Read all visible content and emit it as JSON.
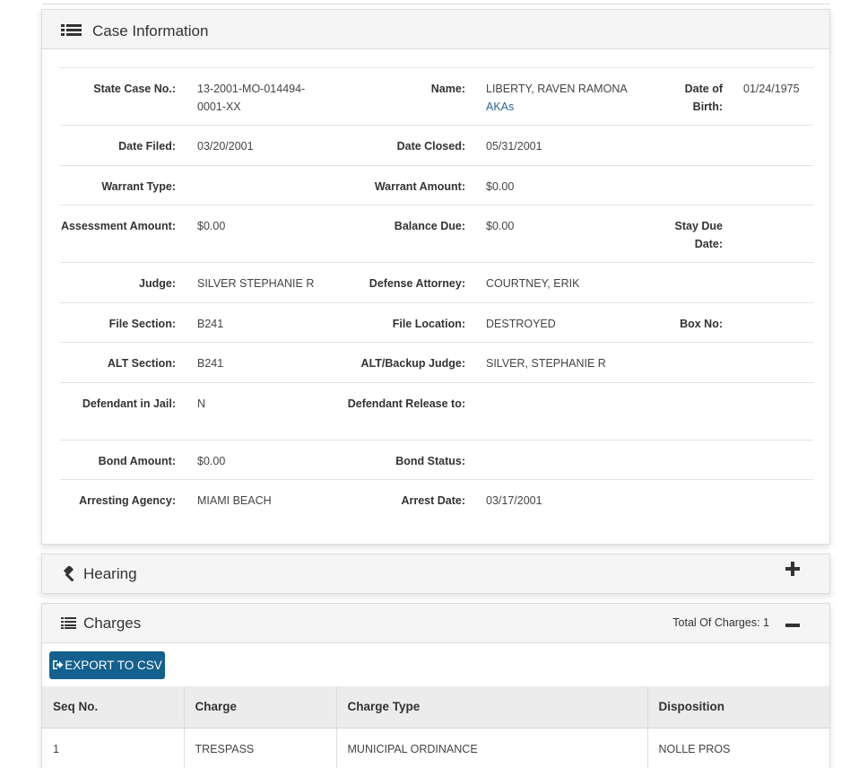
{
  "case_panel": {
    "title": "Case Information",
    "icon": "list-icon",
    "rows": [
      [
        {
          "label": "State Case No.:",
          "value": "13-2001-MO-014494-0001-XX"
        },
        {
          "label": "Name:",
          "value": "LIBERTY, RAVEN RAMONA",
          "link": "AKAs"
        },
        {
          "label": "Date of Birth:",
          "value": "01/24/1975"
        }
      ],
      [
        {
          "label": "Date Filed:",
          "value": "03/20/2001"
        },
        {
          "label": "Date Closed:",
          "value": "05/31/2001"
        },
        {
          "label": "",
          "value": ""
        }
      ],
      [
        {
          "label": "Warrant Type:",
          "value": ""
        },
        {
          "label": "Warrant Amount:",
          "value": "$0.00"
        },
        {
          "label": "",
          "value": ""
        }
      ],
      [
        {
          "label": "Assessment Amount:",
          "value": "$0.00"
        },
        {
          "label": "Balance Due:",
          "value": "$0.00"
        },
        {
          "label": "Stay Due Date:",
          "value": ""
        }
      ],
      [
        {
          "label": "Judge:",
          "value": "SILVER STEPHANIE R"
        },
        {
          "label": "Defense Attorney:",
          "value": "COURTNEY, ERIK"
        },
        {
          "label": "",
          "value": ""
        }
      ],
      [
        {
          "label": "File Section:",
          "value": "B241"
        },
        {
          "label": "File Location:",
          "value": "DESTROYED"
        },
        {
          "label": "Box No:",
          "value": ""
        }
      ],
      [
        {
          "label": "ALT Section:",
          "value": "B241"
        },
        {
          "label": "ALT/Backup Judge:",
          "value": "SILVER, STEPHANIE R"
        },
        {
          "label": "",
          "value": ""
        }
      ],
      [
        {
          "label": "Defendant in Jail:",
          "value": "N"
        },
        {
          "label": "Defendant Release to:",
          "value": ""
        },
        {
          "label": "",
          "value": ""
        }
      ],
      [
        {
          "label": "Bond Amount:",
          "value": "$0.00"
        },
        {
          "label": "Bond Status:",
          "value": ""
        },
        {
          "label": "",
          "value": ""
        }
      ],
      [
        {
          "label": "Arresting Agency:",
          "value": "MIAMI BEACH"
        },
        {
          "label": "Arrest Date:",
          "value": "03/17/2001"
        },
        {
          "label": "",
          "value": ""
        }
      ]
    ]
  },
  "hearing_panel": {
    "title": "Hearing",
    "icon": "gavel-icon",
    "toggle_icon": "plus-icon"
  },
  "charges_panel": {
    "title": "Charges",
    "icon": "list-icon",
    "total_label": "Total Of Charges: 1",
    "toggle_icon": "minus-icon",
    "export_label": "EXPORT TO CSV",
    "columns": [
      "Seq No.",
      "Charge",
      "Charge Type",
      "Disposition"
    ],
    "rows": [
      [
        "1",
        "TRESPASS",
        "MUNICIPAL ORDINANCE",
        "NOLLE PROS"
      ]
    ]
  },
  "colors": {
    "button_bg": "#14608f",
    "link": "#2a6496",
    "panel_heading_bg": "#f5f5f5"
  }
}
